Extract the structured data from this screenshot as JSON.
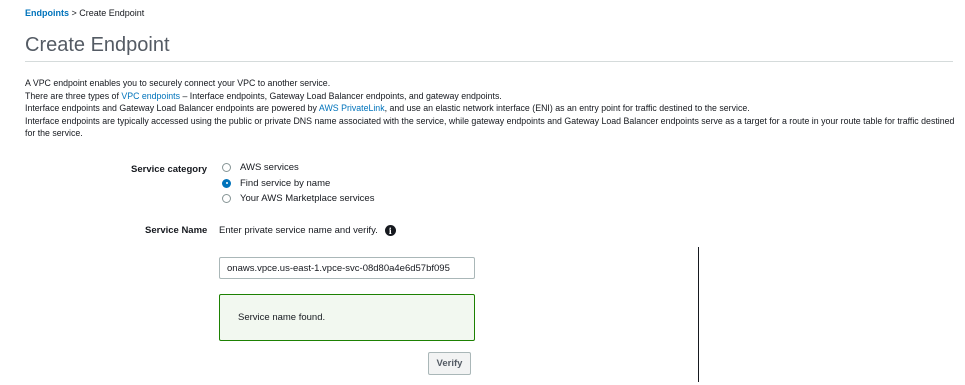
{
  "breadcrumb": {
    "root": "Endpoints",
    "separator": " > ",
    "current": "Create Endpoint"
  },
  "page_title": "Create Endpoint",
  "description": {
    "line1": "A VPC endpoint enables you to securely connect your VPC to another service.",
    "line2_pre": "There are three types of ",
    "line2_link": "VPC endpoints",
    "line2_post": " – Interface endpoints, Gateway Load Balancer endpoints, and gateway endpoints.",
    "line3_pre": "Interface endpoints and Gateway Load Balancer endpoints are powered by ",
    "line3_link": "AWS PrivateLink",
    "line3_post": ", and use an elastic network interface (ENI) as an entry point for traffic destined to the service.",
    "line4": "Interface endpoints are typically accessed using the public or private DNS name associated with the service, while gateway endpoints and Gateway Load Balancer endpoints serve as a target for a route in your route table for traffic destined for the service."
  },
  "service_category": {
    "label": "Service category",
    "options": [
      {
        "label": "AWS services",
        "selected": false
      },
      {
        "label": "Find service by name",
        "selected": true
      },
      {
        "label": "Your AWS Marketplace services",
        "selected": false
      }
    ]
  },
  "service_name": {
    "label": "Service Name",
    "hint": "Enter private service name and verify.",
    "info_icon": "info-icon",
    "value": "onaws.vpce.us-east-1.vpce-svc-08d80a4e6d57bf095",
    "status_message": "Service name found.",
    "verify_label": "Verify"
  },
  "colors": {
    "link": "#0073bb",
    "success_border": "#1d8102",
    "success_bg": "#f2f8f0"
  }
}
